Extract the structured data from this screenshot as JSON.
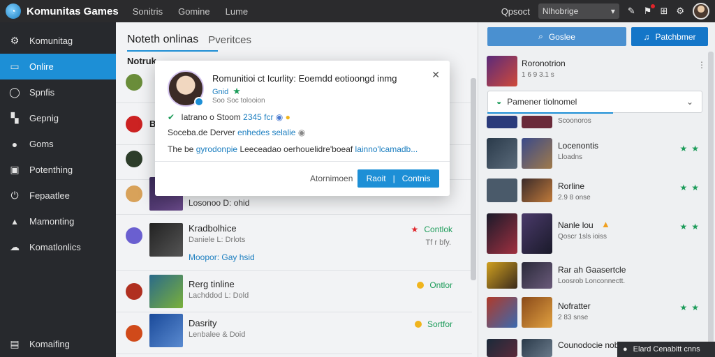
{
  "app": {
    "title": "Komunitas Games"
  },
  "topnav": [
    "Sonitris",
    "Gomine",
    "Lume"
  ],
  "topbar": {
    "label": "Qpsoct",
    "search_value": "Nlhobrige"
  },
  "sidebar": {
    "items": [
      {
        "label": "Komunitag",
        "icon": "gear-icon"
      },
      {
        "label": "Onlire",
        "icon": "monitor-icon",
        "active": true
      },
      {
        "label": "Spnfis",
        "icon": "circle-icon"
      },
      {
        "label": "Gepnig",
        "icon": "chart-icon"
      },
      {
        "label": "Goms",
        "icon": "person-icon"
      },
      {
        "label": "Potenthing",
        "icon": "image-icon"
      },
      {
        "label": "Fepaatlee",
        "icon": "power-icon"
      },
      {
        "label": "Mamonting",
        "icon": "lock-icon"
      },
      {
        "label": "Komatlonlics",
        "icon": "cloud-icon"
      }
    ],
    "bottom_label": "Komaifing"
  },
  "main": {
    "tabs": [
      {
        "label": "Noteth onlinas"
      },
      {
        "label": "Pveritces"
      }
    ],
    "section_heading": "Notruk",
    "rows": [
      {
        "name": "",
        "sub": "",
        "link": ""
      },
      {
        "name": "B",
        "sub": "",
        "link": ""
      },
      {
        "name": "",
        "sub": "",
        "link": ""
      },
      {
        "name": "",
        "sub": "",
        "link": "Losonoo D: ohid"
      },
      {
        "name": "Kradbolhice",
        "sub": "Daniele L: Drlots",
        "link": "Moopor: Gay hsid",
        "status": "Contlok",
        "time": "Tf r bfy."
      },
      {
        "name": "Rerg tinline",
        "sub": "Lachddod L: Dold",
        "link": "",
        "status": "Ontlor"
      },
      {
        "name": "Dasrity",
        "sub": "Lenbalee & Doid",
        "link": "",
        "status": "Sortfor"
      }
    ]
  },
  "right": {
    "search_button": "Goslee",
    "primary_button": "Patchbmer",
    "top_item": {
      "title": "Roronotrion",
      "sub": "1 6 9 3.1 s"
    },
    "dropdown_value": "Pamener tiolnomel",
    "items": [
      {
        "title": "",
        "sub": "Scoonoros"
      },
      {
        "title": "Locenontis",
        "sub": "Lloadns"
      },
      {
        "title": "Rorline",
        "sub": "2.9 8 onse"
      },
      {
        "title": "Nanle lou",
        "sub": "Qoscr 1sls ioiss"
      },
      {
        "title": "Rar ah Gaasertcle",
        "sub": "Loosrob Lonconnectt."
      },
      {
        "title": "Nofratter",
        "sub": "2 83 snse"
      },
      {
        "title": "Counodocie nobuter",
        "sub": ""
      }
    ],
    "toast": "Elard Cenabitt cnns"
  },
  "modal": {
    "title": "Romunitioi ct Icurlity: Eoemdd eotioongd inmg",
    "sub1": "Gnid",
    "sub2": "Soo Soc tolooion",
    "line1_text": "Iatrano o Stoom",
    "line1_num": "2345 fcr",
    "line2_text": "Soceba.de Derver",
    "line2_blue": "enhedes selalie",
    "line3_text": "The be",
    "line3_blue1": "gyrodonpie",
    "line3_mid": "Leeceadao oerhouelidre'boeaf",
    "line3_blue2": "lainno'lcamadb...",
    "cancel_label": "Atornimoen",
    "primary_label_a": "Raoit",
    "primary_label_b": "Contnis"
  },
  "colors": {
    "accent": "#1d8fd6",
    "sidebar": "#27292d",
    "topbar": "#2b2b2d",
    "online": "#1d9c5a"
  }
}
